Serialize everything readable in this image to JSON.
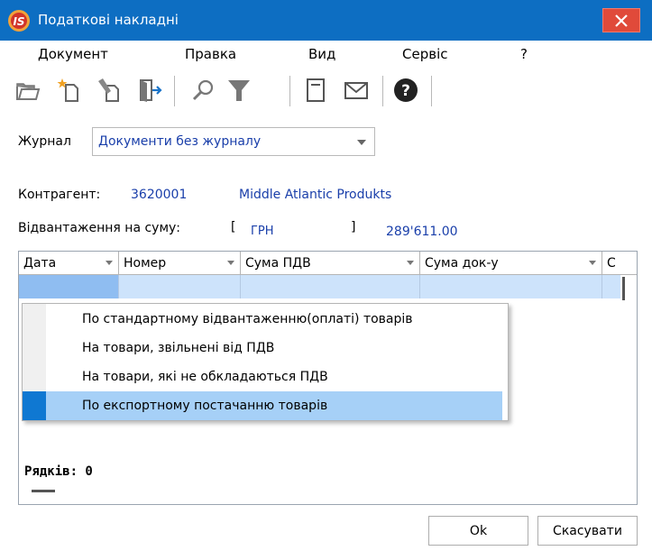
{
  "window": {
    "title": "Податкові накладні",
    "colors": {
      "titlebar": "#0d6ec2",
      "close": "#e04a3a",
      "accent": "#0f78d2",
      "link_text": "#1a3faa"
    }
  },
  "menu": [
    "Документ",
    "Правка",
    "Вид",
    "Сервіс",
    "?"
  ],
  "toolbar": [
    "folder-open-icon",
    "new-document-icon",
    "edit-document-icon",
    "exit-icon",
    "search-icon",
    "filter-icon",
    "form-icon",
    "mail-icon",
    "help-icon"
  ],
  "journal": {
    "label": "Журнал",
    "value": "Документи без журналу"
  },
  "contractor": {
    "label": "Контрагент:",
    "code": "3620001",
    "name": "Middle Atlantic Produkts"
  },
  "shipment": {
    "label": "Відвантаження на суму:",
    "open_bracket": "[",
    "currency": "ГРН",
    "close_bracket": "]",
    "amount": "289'611.00"
  },
  "grid": {
    "columns": [
      "Дата",
      "Номер",
      "Сума ПДВ",
      "Сума  док-у",
      "С"
    ],
    "rows_label": "Рядків: 0"
  },
  "popup": {
    "items": [
      "По стандартному відвантаженню(оплаті) товарів",
      "На товари, звільнені від ПДВ",
      "На товари, які не обкладаються ПДВ",
      "По експортному  постачанню товарів"
    ],
    "active_index": 3
  },
  "buttons": {
    "ok": "Ok",
    "cancel": "Скасувати"
  }
}
